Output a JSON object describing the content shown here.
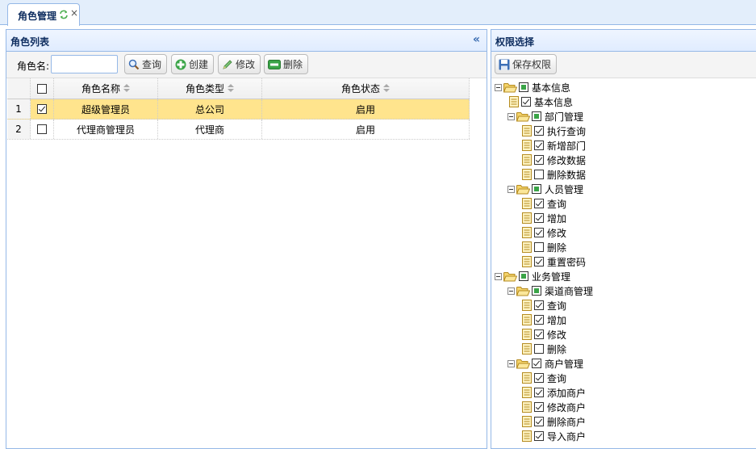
{
  "tab": {
    "label": "角色管理",
    "close": "×"
  },
  "left_panel": {
    "title": "角色列表",
    "collapse": "«",
    "toolbar": {
      "search_label": "角色名:",
      "search_value": "",
      "buttons": {
        "query": "查询",
        "create": "创建",
        "edit": "修改",
        "delete": "删除"
      }
    },
    "grid": {
      "headers": {
        "name": "角色名称",
        "type": "角色类型",
        "status": "角色状态"
      },
      "rows": [
        {
          "num": "1",
          "checked": true,
          "name": "超级管理员",
          "type": "总公司",
          "status": "启用",
          "selected": true
        },
        {
          "num": "2",
          "checked": false,
          "name": "代理商管理员",
          "type": "代理商",
          "status": "启用",
          "selected": false
        }
      ]
    }
  },
  "right_panel": {
    "title": "权限选择",
    "save_button": "保存权限",
    "tree": [
      {
        "label": "基本信息",
        "level": 0,
        "kind": "folder",
        "state": "partial"
      },
      {
        "label": "基本信息",
        "level": 1,
        "kind": "leaf",
        "state": "on"
      },
      {
        "label": "部门管理",
        "level": 1,
        "kind": "folder",
        "state": "partial"
      },
      {
        "label": "执行查询",
        "level": 2,
        "kind": "leaf",
        "state": "on"
      },
      {
        "label": "新增部门",
        "level": 2,
        "kind": "leaf",
        "state": "on"
      },
      {
        "label": "修改数据",
        "level": 2,
        "kind": "leaf",
        "state": "on"
      },
      {
        "label": "删除数据",
        "level": 2,
        "kind": "leaf",
        "state": "off"
      },
      {
        "label": "人员管理",
        "level": 1,
        "kind": "folder",
        "state": "partial"
      },
      {
        "label": "查询",
        "level": 2,
        "kind": "leaf",
        "state": "on"
      },
      {
        "label": "增加",
        "level": 2,
        "kind": "leaf",
        "state": "on"
      },
      {
        "label": "修改",
        "level": 2,
        "kind": "leaf",
        "state": "on"
      },
      {
        "label": "删除",
        "level": 2,
        "kind": "leaf",
        "state": "off"
      },
      {
        "label": "重置密码",
        "level": 2,
        "kind": "leaf",
        "state": "on"
      },
      {
        "label": "业务管理",
        "level": 0,
        "kind": "folder",
        "state": "partial"
      },
      {
        "label": "渠道商管理",
        "level": 1,
        "kind": "folder",
        "state": "partial"
      },
      {
        "label": "查询",
        "level": 2,
        "kind": "leaf",
        "state": "on"
      },
      {
        "label": "增加",
        "level": 2,
        "kind": "leaf",
        "state": "on"
      },
      {
        "label": "修改",
        "level": 2,
        "kind": "leaf",
        "state": "on"
      },
      {
        "label": "删除",
        "level": 2,
        "kind": "leaf",
        "state": "off"
      },
      {
        "label": "商户管理",
        "level": 1,
        "kind": "folder",
        "state": "on"
      },
      {
        "label": "查询",
        "level": 2,
        "kind": "leaf",
        "state": "on"
      },
      {
        "label": "添加商户",
        "level": 2,
        "kind": "leaf",
        "state": "on"
      },
      {
        "label": "修改商户",
        "level": 2,
        "kind": "leaf",
        "state": "on"
      },
      {
        "label": "删除商户",
        "level": 2,
        "kind": "leaf",
        "state": "on"
      },
      {
        "label": "导入商户",
        "level": 2,
        "kind": "leaf",
        "state": "on"
      }
    ]
  }
}
